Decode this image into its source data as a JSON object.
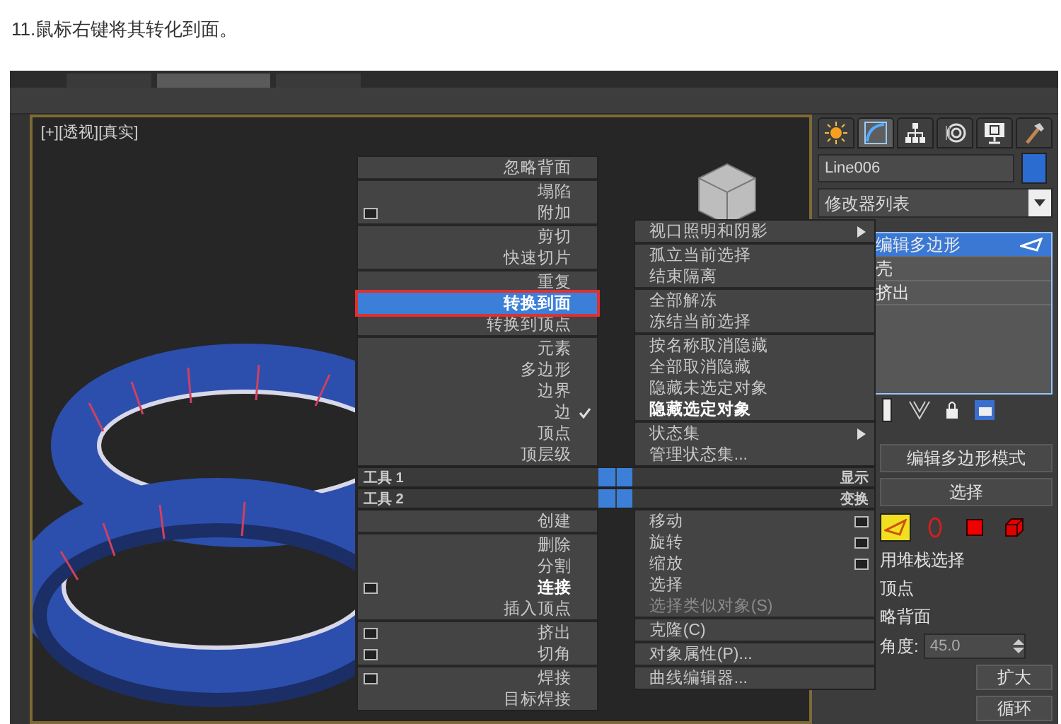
{
  "caption": "11.鼠标右键将其转化到面。",
  "viewport": {
    "label": "[+][透视][真实]"
  },
  "quad_menu": {
    "top_left": [
      {
        "items": [
          {
            "label": "忽略背面",
            "selected": false
          }
        ]
      },
      {
        "items": [
          {
            "label": "塌陷",
            "selected": false
          },
          {
            "label": "附加",
            "selected": false,
            "options": true
          }
        ]
      },
      {
        "items": [
          {
            "label": "剪切",
            "selected": false
          },
          {
            "label": "快速切片",
            "selected": false
          }
        ]
      },
      {
        "items": [
          {
            "label": "重复",
            "selected": false
          },
          {
            "label": "转换到面",
            "selected": true
          },
          {
            "label": "转换到顶点",
            "selected": false
          }
        ]
      },
      {
        "items": [
          {
            "label": "元素",
            "selected": false
          },
          {
            "label": "多边形",
            "selected": false
          },
          {
            "label": "边界",
            "selected": false
          },
          {
            "label": "边",
            "selected": false,
            "checked": true
          },
          {
            "label": "顶点",
            "selected": false
          },
          {
            "label": "顶层级",
            "selected": false
          }
        ]
      }
    ],
    "top_right": [
      {
        "items": [
          {
            "label": "视口照明和阴影",
            "selected": false,
            "submenu": true
          }
        ]
      },
      {
        "items": [
          {
            "label": "孤立当前选择",
            "selected": false
          },
          {
            "label": "结束隔离",
            "selected": false
          }
        ]
      },
      {
        "items": [
          {
            "label": "全部解冻",
            "selected": false
          },
          {
            "label": "冻结当前选择",
            "selected": false
          }
        ]
      },
      {
        "items": [
          {
            "label": "按名称取消隐藏",
            "selected": false
          },
          {
            "label": "全部取消隐藏",
            "selected": false
          },
          {
            "label": "隐藏未选定对象",
            "selected": false
          },
          {
            "label": "隐藏选定对象",
            "selected": false,
            "bold": true
          }
        ]
      },
      {
        "items": [
          {
            "label": "状态集",
            "selected": false,
            "submenu": true
          },
          {
            "label": "管理状态集...",
            "selected": false
          }
        ]
      }
    ],
    "labels": [
      {
        "left": "工具 1",
        "right": "显示"
      },
      {
        "left": "工具 2",
        "right": "变换"
      }
    ],
    "bottom_left": [
      {
        "items": [
          {
            "label": "创建",
            "selected": false
          }
        ]
      },
      {
        "items": [
          {
            "label": "删除",
            "selected": false
          },
          {
            "label": "分割",
            "selected": false
          },
          {
            "label": "连接",
            "selected": false,
            "bold": true,
            "options": true
          },
          {
            "label": "插入顶点",
            "selected": false
          }
        ]
      },
      {
        "items": [
          {
            "label": "挤出",
            "selected": false,
            "options": true
          },
          {
            "label": "切角",
            "selected": false,
            "options": true
          }
        ]
      },
      {
        "items": [
          {
            "label": "焊接",
            "selected": false,
            "options": true
          },
          {
            "label": "目标焊接",
            "selected": false
          }
        ]
      }
    ],
    "bottom_right": [
      {
        "items": [
          {
            "label": "移动",
            "selected": false,
            "options": true
          },
          {
            "label": "旋转",
            "selected": false,
            "options": true
          },
          {
            "label": "缩放",
            "selected": false,
            "options": true
          },
          {
            "label": "选择",
            "selected": false
          },
          {
            "label": "选择类似对象(S)",
            "selected": false,
            "disabled": true
          }
        ]
      },
      {
        "items": [
          {
            "label": "克隆(C)",
            "selected": false
          }
        ]
      },
      {
        "items": [
          {
            "label": "对象属性(P)...",
            "selected": false
          }
        ]
      },
      {
        "items": [
          {
            "label": "曲线编辑器...",
            "selected": false
          }
        ]
      }
    ]
  },
  "command_panel": {
    "tabs": [
      {
        "kind": "create",
        "selected": false
      },
      {
        "kind": "modify",
        "selected": true
      },
      {
        "kind": "hierarchy",
        "selected": false
      },
      {
        "kind": "motion",
        "selected": false
      },
      {
        "kind": "display",
        "selected": false
      },
      {
        "kind": "utilities",
        "selected": false
      }
    ],
    "object_name": "Line006",
    "modifier_list": "修改器列表",
    "modifier_stack": [
      {
        "label": "编辑多边形",
        "selected": true
      },
      {
        "label": "壳",
        "selected": false
      },
      {
        "label": "挤出",
        "selected": false
      }
    ],
    "mode_rollout": "编辑多边形模式",
    "selection_rollout": "选择",
    "selection_levels": [
      {
        "kind": "edge",
        "selected": true
      },
      {
        "kind": "border",
        "selected": false
      },
      {
        "kind": "polygon",
        "selected": false
      },
      {
        "kind": "element",
        "selected": false
      }
    ],
    "options": [
      "用堆栈选择",
      "顶点",
      "略背面"
    ],
    "angle_label": "角度:",
    "angle_value": "45.0",
    "buttons": [
      "扩大",
      "循环"
    ]
  }
}
